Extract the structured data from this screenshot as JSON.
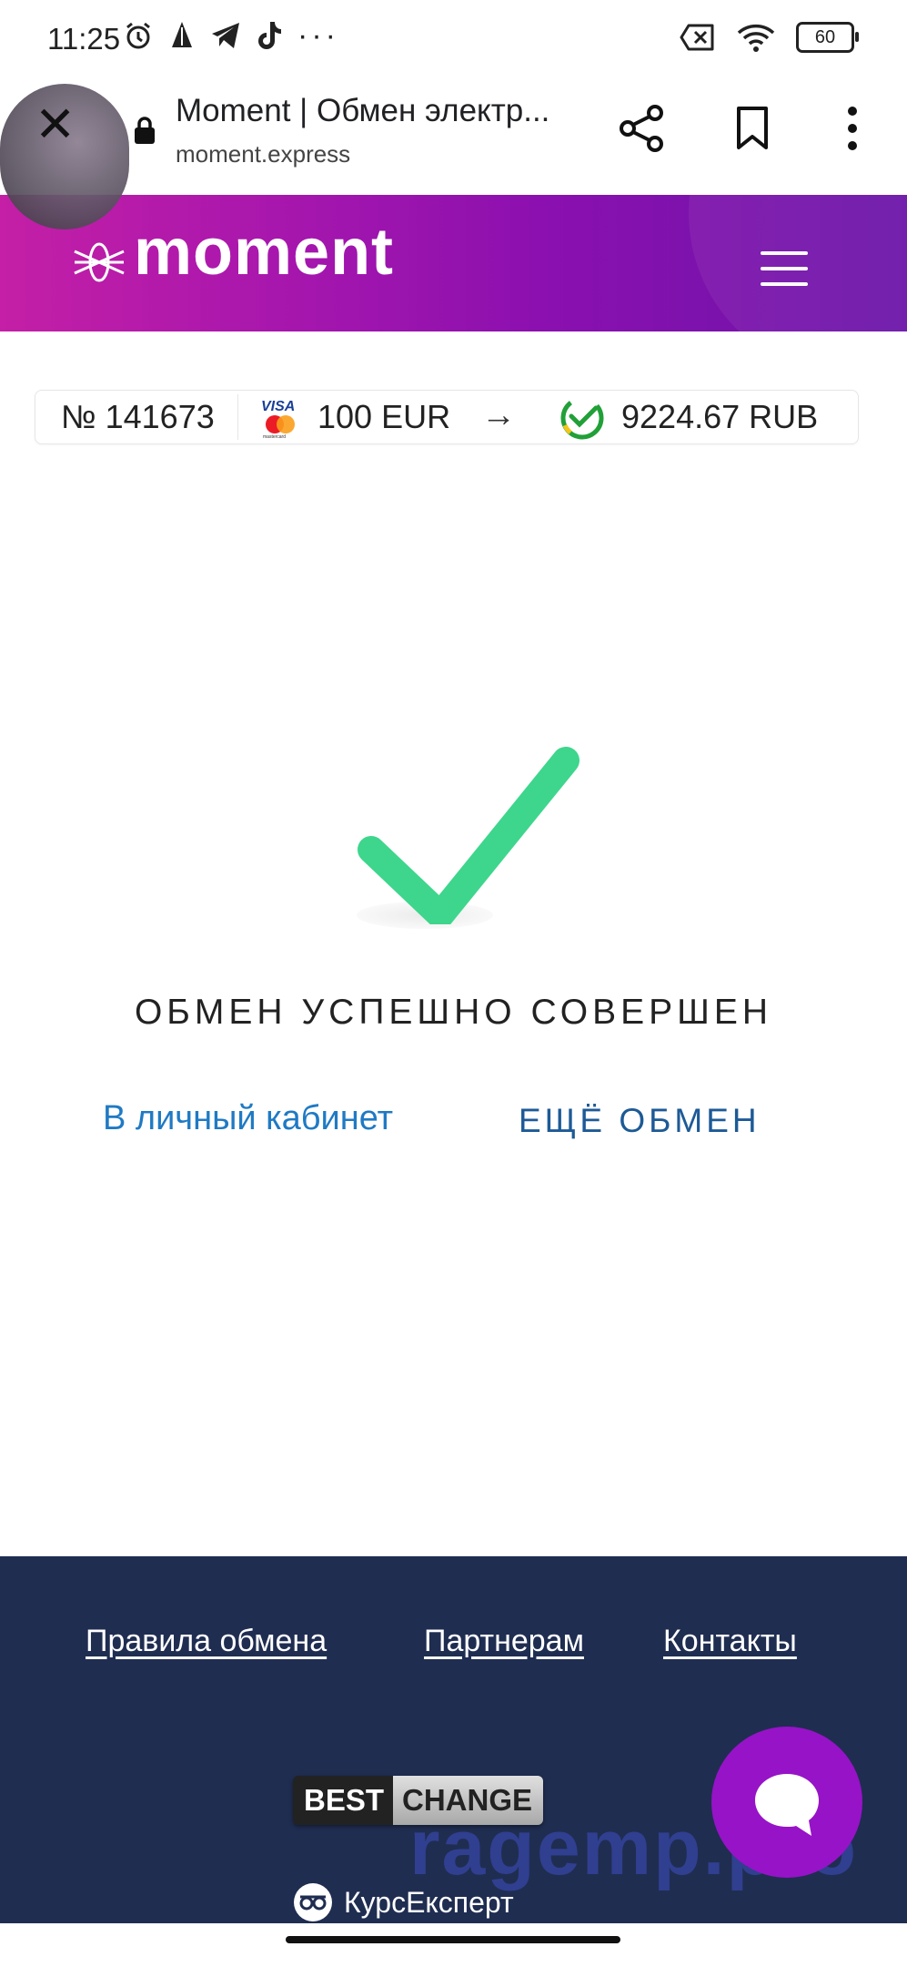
{
  "status_bar": {
    "time": "11:25",
    "more": "···",
    "battery": "60"
  },
  "browser": {
    "title": "Moment | Обмен электр...",
    "url": "moment.express"
  },
  "header": {
    "logo_text": "moment"
  },
  "order": {
    "number": "№ 141673",
    "from_amount": "100 EUR",
    "arrow": "→",
    "to_amount": "9224.67 RUB"
  },
  "result": {
    "message": "ОБМЕН УСПЕШНО СОВЕРШЕН",
    "cabinet_link": "В личный кабинет",
    "again_link": "ЕЩЁ ОБМЕН"
  },
  "footer": {
    "links": [
      "Правила обмена",
      "Партнерам",
      "Контакты"
    ],
    "bestchange_a": "BEST",
    "bestchange_b": "CHANGE",
    "kurs": "КурсЕксперт"
  },
  "watermark": "ragemp.pro",
  "colors": {
    "header_start": "#c41fa6",
    "header_end": "#6b14a8",
    "check_green": "#3dd68c",
    "link_blue": "#1f7ac4",
    "footer_bg": "#1f2d51",
    "chat_purple": "#9713c7"
  }
}
